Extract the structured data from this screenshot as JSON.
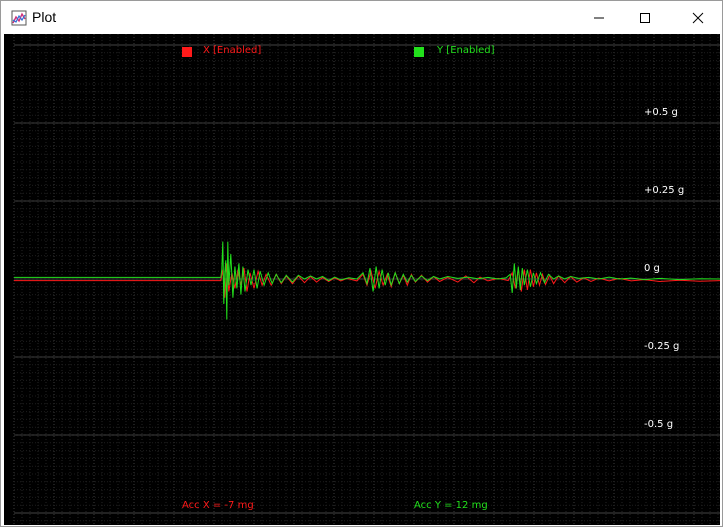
{
  "window": {
    "title": "Plot",
    "controls": {
      "minimize": "minimize",
      "maximize": "maximize",
      "close": "close"
    }
  },
  "colors": {
    "background": "#000000",
    "grid": "#3a3a3a",
    "x_series": "#ff1a1a",
    "y_series": "#22e01c"
  },
  "legend": [
    {
      "label": "X [Enabled]",
      "color": "#ff1a1a"
    },
    {
      "label": "Y [Enabled]",
      "color": "#22e01c"
    }
  ],
  "readouts": {
    "acc_x": "Acc X = -7 mg",
    "acc_y": "Acc Y = 12 mg"
  },
  "chart_data": {
    "type": "line",
    "title": "",
    "y_tick_labels": [
      "+0.5 g",
      "+0.25 g",
      "0 g",
      "-0.25 g",
      "-0.5 g"
    ],
    "y_ticks": [
      0.5,
      0.25,
      0,
      -0.25,
      -0.5
    ],
    "y_unit": "g",
    "ylim": [
      -0.75,
      0.75
    ],
    "xlim": [
      0,
      700
    ],
    "grid": true,
    "legend_placement": "top",
    "series": [
      {
        "name": "X [Enabled]",
        "color": "#ff1a1a",
        "points": [
          [
            0,
            -0.005
          ],
          [
            205,
            -0.005
          ],
          [
            207,
            0.03
          ],
          [
            209,
            -0.06
          ],
          [
            211,
            0.05
          ],
          [
            213,
            -0.04
          ],
          [
            216,
            0.02
          ],
          [
            219,
            -0.03
          ],
          [
            222,
            0.03
          ],
          [
            225,
            -0.02
          ],
          [
            228,
            0.035
          ],
          [
            231,
            -0.04
          ],
          [
            234,
            0.02
          ],
          [
            238,
            -0.03
          ],
          [
            242,
            0.025
          ],
          [
            246,
            -0.02
          ],
          [
            250,
            0.015
          ],
          [
            255,
            -0.02
          ],
          [
            260,
            0.015
          ],
          [
            265,
            -0.015
          ],
          [
            270,
            0.01
          ],
          [
            276,
            -0.015
          ],
          [
            282,
            0.01
          ],
          [
            288,
            -0.012
          ],
          [
            294,
            0.008
          ],
          [
            300,
            -0.01
          ],
          [
            306,
            0.005
          ],
          [
            312,
            -0.008
          ],
          [
            318,
            0.004
          ],
          [
            324,
            -0.006
          ],
          [
            330,
            0.002
          ],
          [
            340,
            -0.006
          ],
          [
            346,
            0.015
          ],
          [
            350,
            -0.02
          ],
          [
            354,
            0.025
          ],
          [
            358,
            -0.03
          ],
          [
            362,
            0.025
          ],
          [
            366,
            -0.02
          ],
          [
            370,
            0.015
          ],
          [
            374,
            -0.025
          ],
          [
            378,
            0.02
          ],
          [
            382,
            -0.015
          ],
          [
            386,
            0.012
          ],
          [
            390,
            -0.02
          ],
          [
            394,
            0.015
          ],
          [
            398,
            -0.01
          ],
          [
            404,
            0.012
          ],
          [
            410,
            -0.01
          ],
          [
            416,
            0.008
          ],
          [
            422,
            -0.008
          ],
          [
            430,
            0.005
          ],
          [
            440,
            -0.01
          ],
          [
            448,
            0.01
          ],
          [
            456,
            -0.012
          ],
          [
            462,
            0.006
          ],
          [
            470,
            -0.006
          ],
          [
            480,
            0.002
          ],
          [
            490,
            -0.005
          ],
          [
            494,
            0.02
          ],
          [
            497,
            -0.03
          ],
          [
            500,
            0.035
          ],
          [
            503,
            -0.04
          ],
          [
            506,
            0.03
          ],
          [
            509,
            -0.035
          ],
          [
            512,
            0.03
          ],
          [
            515,
            -0.025
          ],
          [
            518,
            0.02
          ],
          [
            521,
            -0.02
          ],
          [
            524,
            0.015
          ],
          [
            527,
            -0.018
          ],
          [
            531,
            0.012
          ],
          [
            535,
            -0.015
          ],
          [
            540,
            0.01
          ],
          [
            546,
            -0.012
          ],
          [
            552,
            0.008
          ],
          [
            558,
            -0.01
          ],
          [
            565,
            0.004
          ],
          [
            572,
            -0.008
          ],
          [
            580,
            0.003
          ],
          [
            590,
            -0.006
          ],
          [
            600,
            0.002
          ],
          [
            612,
            -0.006
          ],
          [
            625,
            -0.002
          ],
          [
            640,
            -0.008
          ],
          [
            660,
            -0.004
          ],
          [
            680,
            -0.007
          ],
          [
            700,
            -0.005
          ]
        ]
      },
      {
        "name": "Y [Enabled]",
        "color": "#22e01c",
        "points": [
          [
            0,
            0.005
          ],
          [
            205,
            0.005
          ],
          [
            206,
            0.03
          ],
          [
            207,
            0.12
          ],
          [
            208,
            -0.08
          ],
          [
            209,
            0.02
          ],
          [
            210,
            0.06
          ],
          [
            211,
            -0.13
          ],
          [
            212,
            0.12
          ],
          [
            213,
            -0.02
          ],
          [
            215,
            0.08
          ],
          [
            217,
            -0.06
          ],
          [
            219,
            0.04
          ],
          [
            221,
            -0.03
          ],
          [
            223,
            0.05
          ],
          [
            225,
            -0.05
          ],
          [
            227,
            0.04
          ],
          [
            229,
            -0.04
          ],
          [
            232,
            0.03
          ],
          [
            235,
            -0.02
          ],
          [
            238,
            0.03
          ],
          [
            241,
            -0.03
          ],
          [
            244,
            0.025
          ],
          [
            248,
            -0.02
          ],
          [
            252,
            0.02
          ],
          [
            256,
            -0.015
          ],
          [
            260,
            0.015
          ],
          [
            265,
            -0.012
          ],
          [
            270,
            0.012
          ],
          [
            276,
            -0.01
          ],
          [
            282,
            0.012
          ],
          [
            288,
            0.0
          ],
          [
            294,
            0.01
          ],
          [
            300,
            0.0
          ],
          [
            306,
            0.008
          ],
          [
            312,
            -0.005
          ],
          [
            318,
            0.006
          ],
          [
            324,
            -0.003
          ],
          [
            332,
            0.004
          ],
          [
            340,
            0.0
          ],
          [
            346,
            0.02
          ],
          [
            350,
            -0.015
          ],
          [
            353,
            0.035
          ],
          [
            356,
            -0.04
          ],
          [
            359,
            0.04
          ],
          [
            362,
            -0.03
          ],
          [
            365,
            0.03
          ],
          [
            368,
            -0.02
          ],
          [
            371,
            0.02
          ],
          [
            374,
            -0.02
          ],
          [
            378,
            0.02
          ],
          [
            382,
            -0.015
          ],
          [
            386,
            0.015
          ],
          [
            390,
            -0.01
          ],
          [
            394,
            0.012
          ],
          [
            398,
            -0.008
          ],
          [
            404,
            0.01
          ],
          [
            410,
            -0.005
          ],
          [
            416,
            0.008
          ],
          [
            422,
            0.0
          ],
          [
            430,
            0.008
          ],
          [
            440,
            0.002
          ],
          [
            450,
            0.006
          ],
          [
            460,
            0.001
          ],
          [
            470,
            0.005
          ],
          [
            480,
            0.0
          ],
          [
            488,
            0.004
          ],
          [
            492,
            0.015
          ],
          [
            494,
            -0.045
          ],
          [
            496,
            0.05
          ],
          [
            498,
            -0.03
          ],
          [
            500,
            0.04
          ],
          [
            502,
            -0.035
          ],
          [
            504,
            0.035
          ],
          [
            506,
            -0.02
          ],
          [
            509,
            0.03
          ],
          [
            512,
            -0.025
          ],
          [
            515,
            0.02
          ],
          [
            518,
            -0.015
          ],
          [
            522,
            0.02
          ],
          [
            526,
            -0.012
          ],
          [
            530,
            0.015
          ],
          [
            535,
            0.0
          ],
          [
            540,
            0.01
          ],
          [
            546,
            0.0
          ],
          [
            552,
            0.008
          ],
          [
            560,
            0.002
          ],
          [
            570,
            0.005
          ],
          [
            580,
            0.0
          ],
          [
            590,
            0.006
          ],
          [
            600,
            0.0
          ],
          [
            612,
            0.003
          ],
          [
            625,
            -0.002
          ],
          [
            640,
            0.002
          ],
          [
            660,
            -0.002
          ],
          [
            680,
            0.001
          ],
          [
            700,
            0.0
          ]
        ]
      }
    ]
  }
}
